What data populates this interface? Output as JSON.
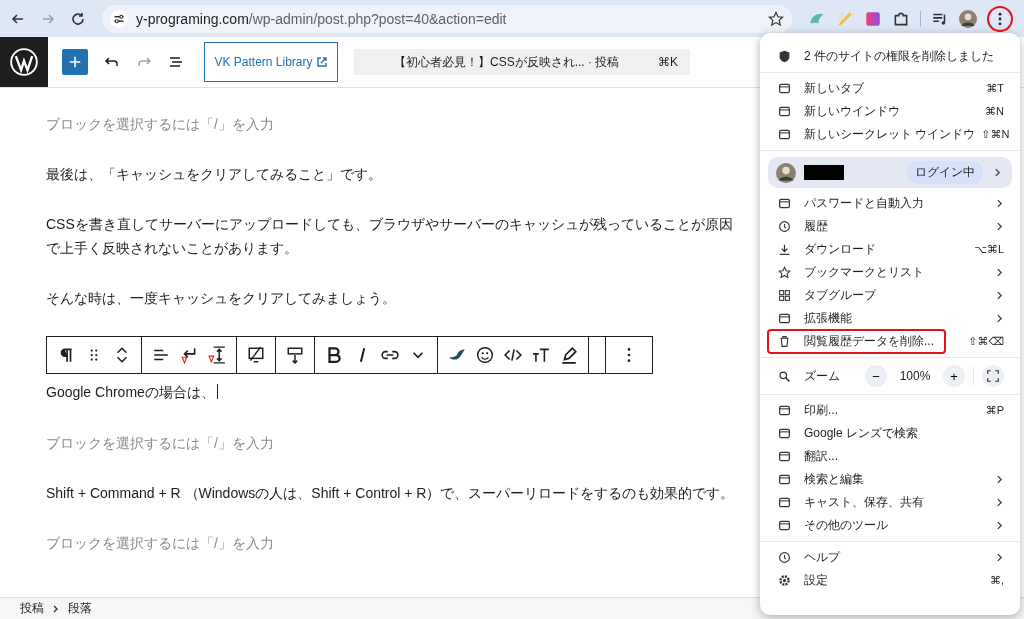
{
  "browser": {
    "url_host": "y-programing.com",
    "url_path": "/wp-admin/post.php?post=40&action=edit",
    "forward_disabled": true,
    "menu_button_highlighted": true
  },
  "editor_header": {
    "pattern_button": "VK Pattern Library",
    "command_title": "【初心者必見！】CSSが反映され... · 投稿",
    "command_shortcut": "⌘K",
    "redo_disabled": true
  },
  "paragraphs": [
    {
      "kind": "placeholder",
      "text": "ブロックを選択するには「/」を入力"
    },
    {
      "kind": "text",
      "text": "最後は、「キャッシュをクリアしてみること」です。"
    },
    {
      "kind": "text",
      "text": "CSSを書き直してサーバーにアップロードしても、ブラウザやサーバーのキャッシュが残っていることが原因で上手く反映されないことがあります。"
    },
    {
      "kind": "text",
      "text": "そんな時は、一度キャッシュをクリアしてみましょう。"
    },
    {
      "kind": "toolbar"
    },
    {
      "kind": "current",
      "text": "Google Chromeの場合は、"
    },
    {
      "kind": "placeholder",
      "text": "ブロックを選択するには「/」を入力"
    },
    {
      "kind": "text",
      "text": "Shift + Command + R （Windowsの人は、Shift + Control + R）で、スーパーリロードをするのも効果的です。"
    },
    {
      "kind": "placeholder",
      "text": "ブロックを選択するには「/」を入力"
    }
  ],
  "breadcrumb": [
    "投稿",
    "段落"
  ],
  "menu": {
    "sections": [
      {
        "items": [
          {
            "kind": "notice",
            "label": "2 件のサイトの権限を削除しました"
          }
        ]
      },
      {
        "items": [
          {
            "kind": "item",
            "label": "新しいタブ",
            "shortcut": "⌘T"
          },
          {
            "kind": "item",
            "label": "新しいウインドウ",
            "shortcut": "⌘N"
          },
          {
            "kind": "item",
            "label": "新しいシークレット ウインドウ",
            "shortcut": "⇧⌘N"
          }
        ]
      },
      {
        "items": [
          {
            "kind": "profile",
            "badge": "ログイン中",
            "submenu": true
          },
          {
            "kind": "item",
            "label": "パスワードと自動入力",
            "submenu": true
          },
          {
            "kind": "item",
            "label": "履歴",
            "submenu": true
          },
          {
            "kind": "item",
            "label": "ダウンロード",
            "shortcut": "⌥⌘L"
          },
          {
            "kind": "item",
            "label": "ブックマークとリスト",
            "submenu": true
          },
          {
            "kind": "item",
            "label": "タブグループ",
            "submenu": true
          },
          {
            "kind": "item",
            "label": "拡張機能",
            "submenu": true
          },
          {
            "kind": "item",
            "label": "閲覧履歴データを削除...",
            "shortcut": "⇧⌘⌫",
            "highlighted": true
          }
        ]
      },
      {
        "items": [
          {
            "kind": "zoom",
            "label": "ズーム",
            "minus": "−",
            "value": "100%",
            "plus": "+"
          }
        ]
      },
      {
        "items": [
          {
            "kind": "item",
            "label": "印刷...",
            "shortcut": "⌘P"
          },
          {
            "kind": "item",
            "label": "Google レンズで検索"
          },
          {
            "kind": "item",
            "label": "翻訳..."
          },
          {
            "kind": "item",
            "label": "検索と編集",
            "submenu": true
          },
          {
            "kind": "item",
            "label": "キャスト、保存、共有",
            "submenu": true
          },
          {
            "kind": "item",
            "label": "その他のツール",
            "submenu": true
          }
        ]
      },
      {
        "items": [
          {
            "kind": "item",
            "label": "ヘルプ",
            "submenu": true
          },
          {
            "kind": "item",
            "label": "設定",
            "shortcut": "⌘,"
          }
        ]
      }
    ]
  }
}
